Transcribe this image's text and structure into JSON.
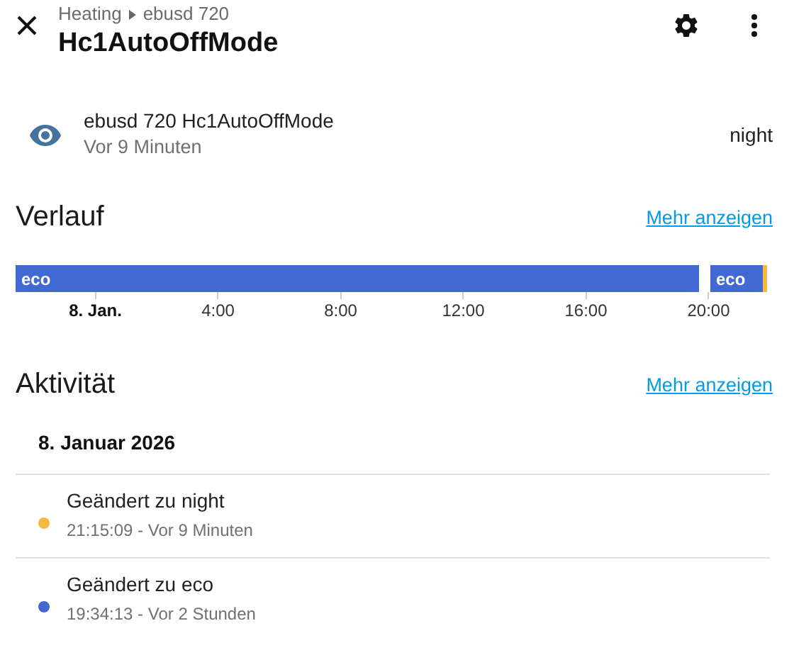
{
  "header": {
    "breadcrumb": [
      "Heating",
      "ebusd 720"
    ],
    "title": "Hc1AutoOffMode"
  },
  "entity": {
    "name": "ebusd 720 Hc1AutoOffMode",
    "time": "Vor 9 Minuten",
    "state": "night"
  },
  "history": {
    "heading": "Verlauf",
    "link": "Mehr anzeigen",
    "segments": [
      {
        "kind": "state",
        "label": "eco",
        "color": "#4169d1"
      },
      {
        "kind": "gap"
      },
      {
        "kind": "state",
        "label": "eco",
        "color": "#4169d1"
      },
      {
        "kind": "state",
        "color": "#f5b942"
      }
    ],
    "ticks": [
      {
        "label": "8. Jan.",
        "bold": true
      },
      {
        "label": "4:00",
        "bold": false
      },
      {
        "label": "8:00",
        "bold": false
      },
      {
        "label": "12:00",
        "bold": false
      },
      {
        "label": "16:00",
        "bold": false
      },
      {
        "label": "20:00",
        "bold": false
      }
    ]
  },
  "activity": {
    "heading": "Aktivität",
    "link": "Mehr anzeigen",
    "date": "8. Januar 2026",
    "entries": [
      {
        "title": "Geändert zu night",
        "detail": "21:15:09 - Vor 9 Minuten",
        "color": "#f5b942"
      },
      {
        "title": "Geändert zu eco",
        "detail": "19:34:13 - Vor 2 Stunden",
        "color": "#4169d1"
      }
    ]
  }
}
